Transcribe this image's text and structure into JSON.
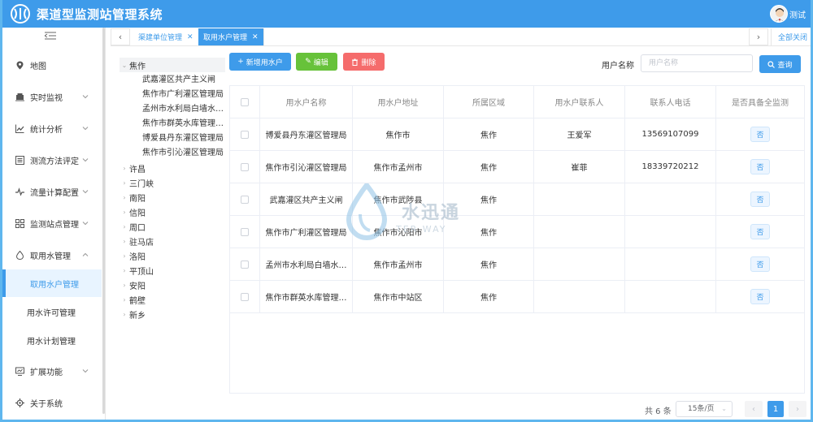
{
  "app": {
    "title": "渠道型监测站管理系统",
    "user_name": "测试"
  },
  "sidebar": {
    "items": [
      {
        "label": "地图",
        "icon": "map-pin-icon",
        "expandable": false
      },
      {
        "label": "实时监视",
        "icon": "monitor-icon",
        "expandable": true
      },
      {
        "label": "统计分析",
        "icon": "bar-chart-icon",
        "expandable": true
      },
      {
        "label": "测流方法评定",
        "icon": "list-icon",
        "expandable": true
      },
      {
        "label": "流量计算配置",
        "icon": "pulse-icon",
        "expandable": true
      },
      {
        "label": "监测站点管理",
        "icon": "sitemap-icon",
        "expandable": true
      },
      {
        "label": "取用水管理",
        "icon": "water-drop-icon",
        "expandable": true,
        "open": true
      },
      {
        "label": "扩展功能",
        "icon": "dashboard-icon",
        "expandable": true
      },
      {
        "label": "关于系统",
        "icon": "gear-icon",
        "expandable": false
      }
    ],
    "sub_items": [
      {
        "label": "取用水户管理",
        "active": true
      },
      {
        "label": "用水许可管理",
        "active": false
      },
      {
        "label": "用水计划管理",
        "active": false
      }
    ]
  },
  "tabs": {
    "items": [
      {
        "label": "渠建单位管理",
        "active": false
      },
      {
        "label": "取用水户管理",
        "active": true
      }
    ],
    "close_all": "全部关闭"
  },
  "tree": {
    "root": "焦作",
    "leaves": [
      "武嘉灌区共产主义闸",
      "焦作市广利灌区管理局",
      "孟州市水利局白墙水…",
      "焦作市群英水库管理…",
      "博爱县丹东灌区管理局",
      "焦作市引沁灌区管理局"
    ],
    "others": [
      "许昌",
      "三门峡",
      "南阳",
      "信阳",
      "周口",
      "驻马店",
      "洛阳",
      "平顶山",
      "安阳",
      "鹤壁",
      "新乡"
    ]
  },
  "toolbar": {
    "add_label": "新增用水户",
    "edit_label": "编辑",
    "delete_label": "删除",
    "search_label": "用户名称",
    "search_placeholder": "用户名称",
    "search_button": "查询"
  },
  "table": {
    "headers": [
      "用水户名称",
      "用水户地址",
      "所属区域",
      "用水户联系人",
      "联系人电话",
      "是否具备全监测"
    ],
    "rows": [
      [
        "博爱县丹东灌区管理局",
        "焦作市",
        "焦作",
        "王爱军",
        "13569107099",
        "否"
      ],
      [
        "焦作市引沁灌区管理局",
        "焦作市孟州市",
        "焦作",
        "崔菲",
        "18339720212",
        "否"
      ],
      [
        "武嘉灌区共产主义闸",
        "焦作市武陟县",
        "焦作",
        "",
        "",
        "否"
      ],
      [
        "焦作市广利灌区管理局",
        "焦作市沁阳市",
        "焦作",
        "",
        "",
        "否"
      ],
      [
        "孟州市水利局白墙水…",
        "焦作市孟州市",
        "焦作",
        "",
        "",
        "否"
      ],
      [
        "焦作市群英水库管理…",
        "焦作市中站区",
        "焦作",
        "",
        "",
        "否"
      ]
    ]
  },
  "pagination": {
    "total": "共 6 条",
    "page_size": "15条/页",
    "current_page": "1"
  },
  "watermark": {
    "text": "水迅通",
    "sub": "TER WAY"
  },
  "colors": {
    "primary": "#3e9bea",
    "success": "#67c23a",
    "danger": "#f56c6c"
  }
}
